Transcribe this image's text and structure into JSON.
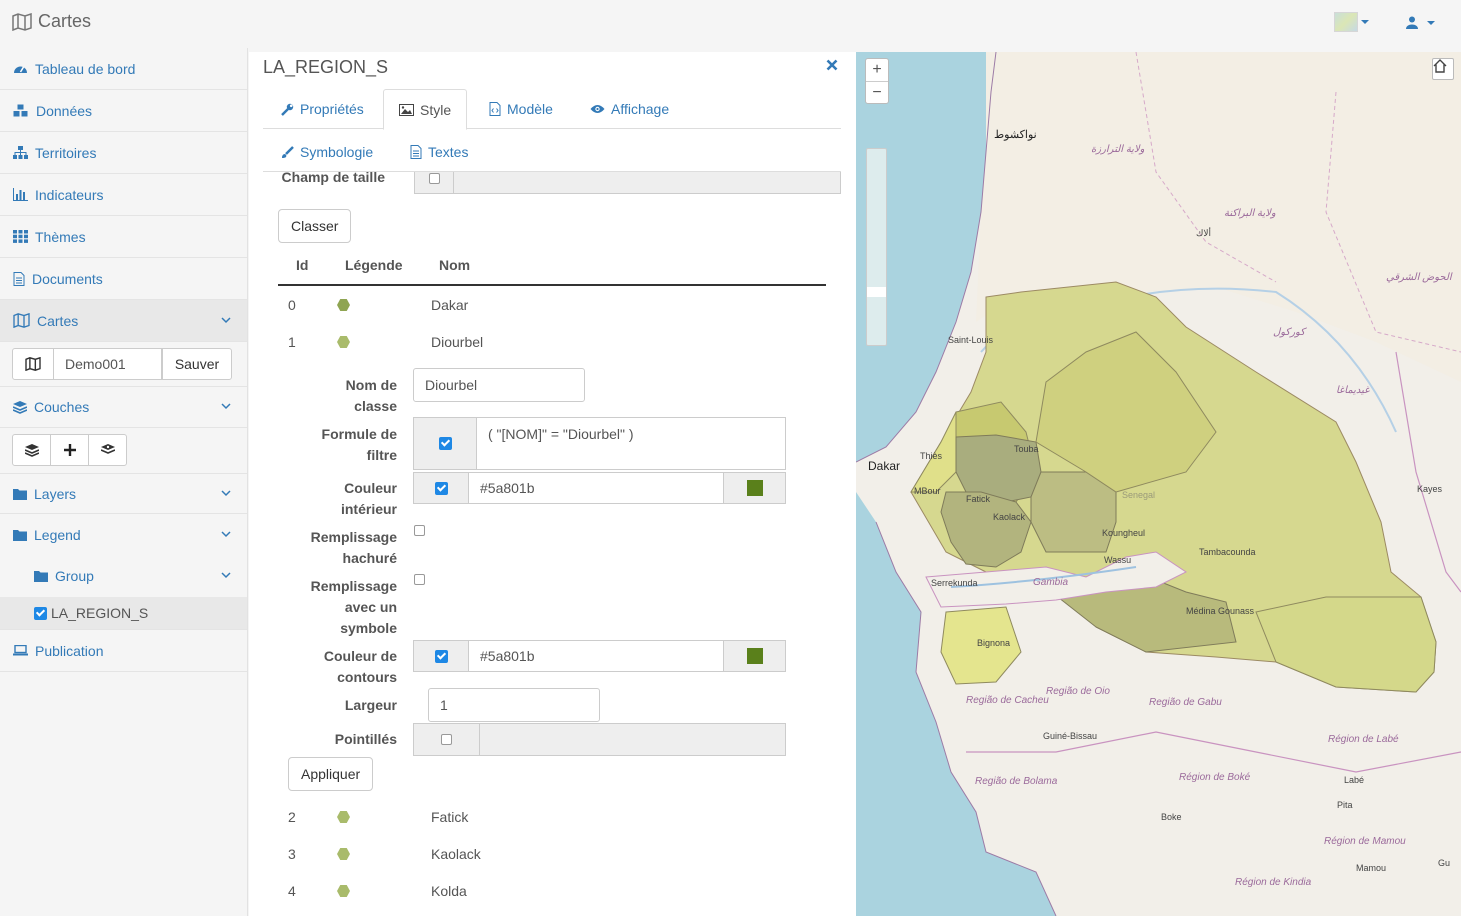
{
  "app": {
    "title": "Cartes"
  },
  "sidebar": {
    "items": [
      {
        "label": "Tableau de bord",
        "icon": "dashboard-icon"
      },
      {
        "label": "Données",
        "icon": "cubes-icon"
      },
      {
        "label": "Territoires",
        "icon": "sitemap-icon"
      },
      {
        "label": "Indicateurs",
        "icon": "bar-chart-icon"
      },
      {
        "label": "Thèmes",
        "icon": "grid-icon"
      },
      {
        "label": "Documents",
        "icon": "file-icon"
      },
      {
        "label": "Cartes",
        "icon": "map-icon"
      },
      {
        "label": "Couches",
        "icon": "layers-icon"
      },
      {
        "label": "Layers",
        "icon": "folder-icon"
      },
      {
        "label": "Legend",
        "icon": "folder-icon"
      },
      {
        "label": "Group",
        "icon": "folder-icon"
      },
      {
        "label": "LA_REGION_S",
        "icon": "checkbox-icon"
      },
      {
        "label": "Publication",
        "icon": "laptop-icon"
      }
    ],
    "map_name": "Demo001",
    "save_label": "Sauver"
  },
  "panel": {
    "title": "LA_REGION_S",
    "tabs": [
      {
        "label": "Propriétés"
      },
      {
        "label": "Style"
      },
      {
        "label": "Modèle"
      },
      {
        "label": "Affichage"
      }
    ],
    "subtabs": [
      {
        "label": "Symbologie"
      },
      {
        "label": "Textes"
      }
    ],
    "size_field_label": "Champ de taille",
    "classify_label": "Classer",
    "table": {
      "headers": [
        "Id",
        "Légende",
        "Nom"
      ],
      "rows": [
        {
          "id": "0",
          "name": "Dakar"
        },
        {
          "id": "1",
          "name": "Diourbel"
        },
        {
          "id": "2",
          "name": "Fatick"
        },
        {
          "id": "3",
          "name": "Kaolack"
        },
        {
          "id": "4",
          "name": "Kolda"
        }
      ]
    },
    "form": {
      "class_name_label": "Nom de classe",
      "class_name_l1": "Nom de",
      "class_name_l2": "classe",
      "class_name_value": "Diourbel",
      "filter_l1": "Formule de",
      "filter_l2": "filtre",
      "filter_value": "( \"[NOM]\" = \"Diourbel\"  )",
      "fill_l1": "Couleur",
      "fill_l2": "intérieur",
      "fill_color": "#5a801b",
      "hatch_l1": "Remplissage",
      "hatch_l2": "hachuré",
      "symbol_l1": "Remplissage",
      "symbol_l2": "avec un",
      "symbol_l3": "symbole",
      "stroke_l1": "Couleur de",
      "stroke_l2": "contours",
      "stroke_color": "#5a801b",
      "width_label": "Largeur",
      "width_value": "1",
      "dash_label": "Pointillés",
      "apply_label": "Appliquer"
    }
  },
  "map": {
    "labels": {
      "nouakchott": "نواكشوط",
      "trarza": "ولاية الترارزة",
      "brakna": "ولاية البراكنة",
      "aleg": "ألاك",
      "hodh": "الحوض الشرقي",
      "gorgol": "كوركول",
      "guidimaka": "غيديماغا",
      "saint_louis": "Saint-Louis",
      "dakar": "Dakar",
      "thies": "Thiès",
      "touba": "Touba",
      "mbour": "MBour",
      "fatick": "Fatick",
      "kaolack": "Kaolack",
      "senegal": "Senegal",
      "koungheul": "Koungheul",
      "kayes": "Kayes",
      "tambacounda": "Tambacounda",
      "wassu": "Wassu",
      "serrekunda": "Serrekunda",
      "gambia": "Gambia",
      "medina": "Médina Gounass",
      "bignona": "Bignona",
      "oio": "Região de Oio",
      "cacheu": "Região de Cacheu",
      "gabu": "Região de Gabu",
      "guinebissau": "Guiné-Bissau",
      "labe_region": "Région de Labé",
      "bolama": "Região de Bolama",
      "boke_region": "Région de Boké",
      "labe": "Labé",
      "pita": "Pita",
      "boke": "Boke",
      "mamou_region": "Région de Mamou",
      "mamou": "Mamou",
      "kindia": "Région de Kindia",
      "gu": "Gu"
    }
  },
  "colors": {
    "accent": "#337ab7",
    "legend_dark": "#8fa552",
    "legend_light": "#a9bb6b",
    "region_fill": "#5a801b"
  }
}
